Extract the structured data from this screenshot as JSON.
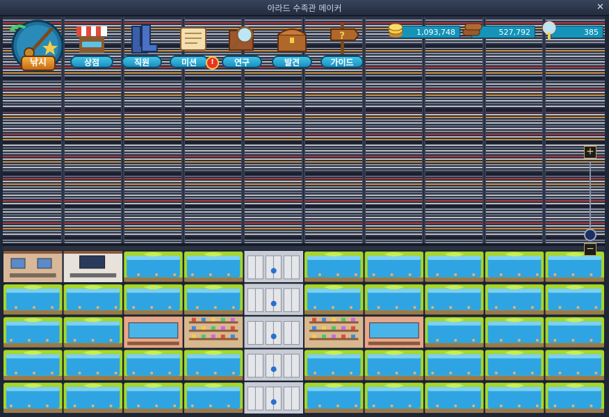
{
  "window": {
    "title": "아라드 수족관 메이커",
    "close": "✕"
  },
  "menu": {
    "fishing": "낚시",
    "items": [
      {
        "key": "shop",
        "label": "상점"
      },
      {
        "key": "staff",
        "label": "직원"
      },
      {
        "key": "mission",
        "label": "미션",
        "alert": "!"
      },
      {
        "key": "research",
        "label": "연구"
      },
      {
        "key": "discover",
        "label": "발견"
      },
      {
        "key": "guide",
        "label": "가이드"
      }
    ]
  },
  "resources": {
    "gold": "1,093,748",
    "wood": "527,792",
    "research": "385"
  },
  "zoom": {
    "plus": "+",
    "minus": "−",
    "level": 0.05
  },
  "grid": {
    "columns": 10,
    "rows": [
      [
        "office",
        "lab",
        "tank",
        "tank",
        "elevator",
        "tank",
        "tank",
        "tank",
        "tank",
        "tank"
      ],
      [
        "tank",
        "tank",
        "tank",
        "tank",
        "elevator",
        "tank",
        "tank",
        "tank",
        "tank",
        "tank"
      ],
      [
        "tank",
        "tank",
        "aquarium",
        "shop",
        "elevator",
        "shop",
        "aquarium",
        "tank",
        "tank",
        "tank"
      ],
      [
        "tank",
        "tank",
        "tank",
        "tank",
        "elevator",
        "tank",
        "tank",
        "tank",
        "tank",
        "tank"
      ],
      [
        "tank",
        "tank",
        "tank",
        "tank",
        "elevator",
        "tank",
        "tank",
        "tank",
        "tank",
        "tank"
      ]
    ]
  },
  "colors": {
    "tank_rim": "#a6d72a",
    "water": "#2fa4e2",
    "accent": "#1593b9",
    "frame": "#1e2738"
  }
}
